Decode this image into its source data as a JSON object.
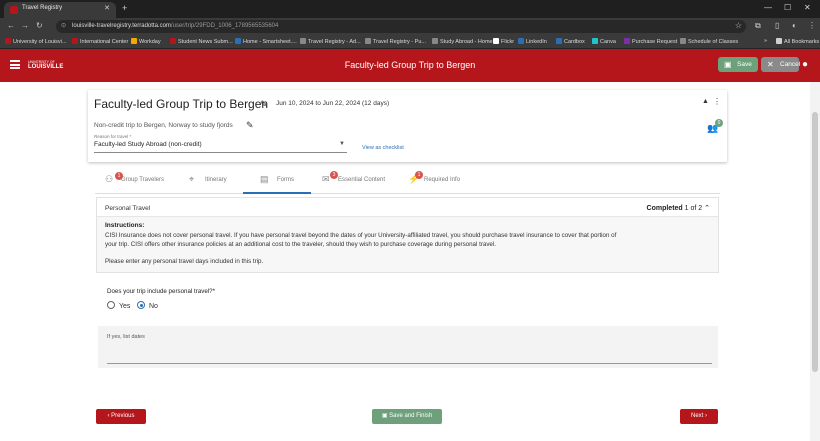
{
  "browser": {
    "tab_title": "Travel Registry",
    "new_tab": "+",
    "url_domain": "louisville-travelregistry.terradotta.com",
    "url_path": "/user/trip/29FDD_1006_1789565535604",
    "bookmarks": [
      {
        "label": "University of Louisvi...",
        "color": "#b4161b"
      },
      {
        "label": "International Center",
        "color": "#b4161b"
      },
      {
        "label": "Workday",
        "color": "#f2a900"
      },
      {
        "label": "Student News Subm...",
        "color": "#b4161b"
      },
      {
        "label": "Home - Smartsheet....",
        "color": "#2a6fb3"
      },
      {
        "label": "Travel Registry - Ad...",
        "color": "#888888"
      },
      {
        "label": "Travel Registry - Pu...",
        "color": "#888888"
      },
      {
        "label": "Study Abroad - Home",
        "color": "#888888"
      },
      {
        "label": "Flickr",
        "color": "#ffffff"
      },
      {
        "label": "LinkedIn",
        "color": "#2a6fb3"
      },
      {
        "label": "Cardbox",
        "color": "#2a6fb3"
      },
      {
        "label": "Canva",
        "color": "#20c4cb"
      },
      {
        "label": "Purchase Request",
        "color": "#7b2fa8"
      },
      {
        "label": "Schedule of Classes",
        "color": "#888888"
      }
    ],
    "bookmarks_more": "»",
    "all_bookmarks": "All Bookmarks"
  },
  "header": {
    "logo_small": "UNIVERSITY OF",
    "logo": "LOUISVILLE",
    "title": "Faculty-led Group Trip to Bergen",
    "save_label": "Save",
    "cancel_label": "Cancel"
  },
  "trip": {
    "title": "Faculty-led Group Trip to Bergen",
    "dates": "Jun 10, 2024 to Jun 22, 2024  (12 days)",
    "description": "Non-credit trip to Bergen, Norway to study fjords",
    "reason_label": "Reason for travel *",
    "reason_value": "Faculty-led Study Abroad (non-credit)",
    "view_checklist": "View as checklist",
    "travelers_count": "0"
  },
  "tabs": [
    {
      "label": "Group Travelers",
      "badge": "1"
    },
    {
      "label": "Itinerary",
      "badge": ""
    },
    {
      "label": "Forms",
      "badge": ""
    },
    {
      "label": "Essential Content",
      "badge": "3"
    },
    {
      "label": "Required Info",
      "badge": "1"
    }
  ],
  "panel": {
    "title": "Personal Travel",
    "completed_label": "Completed",
    "completed_count": "1 of 2",
    "instructions_heading": "Instructions:",
    "instructions_text": "CISI Insurance does not cover personal travel. If you have personal travel beyond the dates of your University-affiliated travel, you should purchase travel insurance to cover that portion of your trip. CISI offers other insurance policies at an additional cost to the traveler, should they wish to purchase coverage during personal travel.",
    "instructions_note": "Please enter any personal travel days included in this trip."
  },
  "question": {
    "label": "Does your trip include personal travel?*",
    "yes": "Yes",
    "no": "No",
    "selected": "No"
  },
  "dates_field": {
    "label": "If yes, list dates"
  },
  "footer": {
    "previous": "Previous",
    "save_finish": "Save and Finish",
    "next": "Next"
  }
}
